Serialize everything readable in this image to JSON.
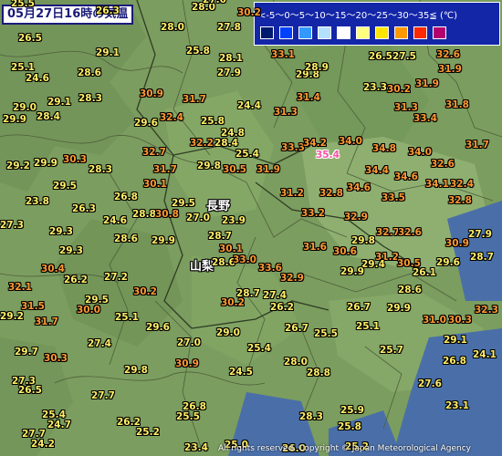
{
  "title": "05月27日16時の気温",
  "legend": {
    "scale_text": "<-5～0～5～10～15～20～25～30～35≦ (℃)",
    "colors": [
      "#001a6e",
      "#0040ff",
      "#3399ff",
      "#b3e0ff",
      "#ffffff",
      "#ffff80",
      "#ffe600",
      "#ff9900",
      "#ff2800",
      "#b4006e"
    ]
  },
  "places": {
    "nagano": "長野",
    "yamanashi": "山梨"
  },
  "copyright": "All rights reserved. Copyright © Japan Meteorological Agency",
  "max_value": "35.4",
  "colors": {
    "hot": "#ff9933",
    "warm": "#ffee66",
    "max": "#ff4fa6"
  },
  "temperatures": [
    {
      "v": "28.0"
    },
    {
      "v": "27.0"
    },
    {
      "v": "26.3"
    },
    {
      "v": "28.0"
    },
    {
      "v": "27.8"
    },
    {
      "v": "30.2"
    },
    {
      "v": "25.5"
    },
    {
      "v": "26.5"
    },
    {
      "v": "29.1"
    },
    {
      "v": "25.8"
    },
    {
      "v": "28.1"
    },
    {
      "v": "33.1"
    },
    {
      "v": "26.5"
    },
    {
      "v": "27.5"
    },
    {
      "v": "32.6"
    },
    {
      "v": "25.1"
    },
    {
      "v": "24.6"
    },
    {
      "v": "27.9"
    },
    {
      "v": "28.6"
    },
    {
      "v": "29.8"
    },
    {
      "v": "28.9"
    },
    {
      "v": "31.9"
    },
    {
      "v": "29.0"
    },
    {
      "v": "29.1"
    },
    {
      "v": "28.3"
    },
    {
      "v": "30.9"
    },
    {
      "v": "31.7"
    },
    {
      "v": "31.4"
    },
    {
      "v": "23.3"
    },
    {
      "v": "30.2"
    },
    {
      "v": "31.9"
    },
    {
      "v": "28.4"
    },
    {
      "v": "29.9"
    },
    {
      "v": "24.4"
    },
    {
      "v": "31.3"
    },
    {
      "v": "31.3"
    },
    {
      "v": "31.8"
    },
    {
      "v": "29.6"
    },
    {
      "v": "32.4"
    },
    {
      "v": "25.8"
    },
    {
      "v": "33.4"
    },
    {
      "v": "24.8"
    },
    {
      "v": "32.7"
    },
    {
      "v": "32.2"
    },
    {
      "v": "28.4"
    },
    {
      "v": "33.3"
    },
    {
      "v": "34.2"
    },
    {
      "v": "34.0"
    },
    {
      "v": "34.8"
    },
    {
      "v": "34.0"
    },
    {
      "v": "31.7"
    },
    {
      "v": "29.2"
    },
    {
      "v": "29.9"
    },
    {
      "v": "30.3"
    },
    {
      "v": "25.4"
    },
    {
      "v": "32.6"
    },
    {
      "v": "28.3"
    },
    {
      "v": "31.7"
    },
    {
      "v": "29.8"
    },
    {
      "v": "30.5"
    },
    {
      "v": "31.9"
    },
    {
      "v": "34.4"
    },
    {
      "v": "34.6"
    },
    {
      "v": "34.1"
    },
    {
      "v": "30.1"
    },
    {
      "v": "34.6"
    },
    {
      "v": "32.4"
    },
    {
      "v": "23.8"
    },
    {
      "v": "29.5"
    },
    {
      "v": "26.8"
    },
    {
      "v": "31.2"
    },
    {
      "v": "32.8"
    },
    {
      "v": "33.5"
    },
    {
      "v": "32.8"
    },
    {
      "v": "26.3"
    },
    {
      "v": "29.5"
    },
    {
      "v": "27.3"
    },
    {
      "v": "24.6"
    },
    {
      "v": "28.8"
    },
    {
      "v": "30.8"
    },
    {
      "v": "27.0"
    },
    {
      "v": "23.9"
    },
    {
      "v": "33.2"
    },
    {
      "v": "32.9"
    },
    {
      "v": "32.7"
    },
    {
      "v": "32.6"
    },
    {
      "v": "29.3"
    },
    {
      "v": "28.6"
    },
    {
      "v": "29.9"
    },
    {
      "v": "28.7"
    },
    {
      "v": "29.8"
    },
    {
      "v": "30.9"
    },
    {
      "v": "27.9"
    },
    {
      "v": "29.3"
    },
    {
      "v": "30.1"
    },
    {
      "v": "31.6"
    },
    {
      "v": "30.6"
    },
    {
      "v": "31.2"
    },
    {
      "v": "29.4"
    },
    {
      "v": "29.6"
    },
    {
      "v": "28.7"
    },
    {
      "v": "30.4"
    },
    {
      "v": "26.2"
    },
    {
      "v": "27.2"
    },
    {
      "v": "28.6"
    },
    {
      "v": "33.0"
    },
    {
      "v": "33.6"
    },
    {
      "v": "29.9"
    },
    {
      "v": "30.5"
    },
    {
      "v": "26.1"
    },
    {
      "v": "32.1"
    },
    {
      "v": "30.2"
    },
    {
      "v": "28.7"
    },
    {
      "v": "27.4"
    },
    {
      "v": "32.9"
    },
    {
      "v": "28.6"
    },
    {
      "v": "29.5"
    },
    {
      "v": "30.2"
    },
    {
      "v": "26.2"
    },
    {
      "v": "31.5"
    },
    {
      "v": "30.0"
    },
    {
      "v": "26.7"
    },
    {
      "v": "29.9"
    },
    {
      "v": "32.3"
    },
    {
      "v": "30.3"
    },
    {
      "v": "29.2"
    },
    {
      "v": "25.1"
    },
    {
      "v": "31.7"
    },
    {
      "v": "29.6"
    },
    {
      "v": "26.7"
    },
    {
      "v": "25.1"
    },
    {
      "v": "31.0"
    },
    {
      "v": "29.0"
    },
    {
      "v": "25.5"
    },
    {
      "v": "27.4"
    },
    {
      "v": "27.0"
    },
    {
      "v": "25.4"
    },
    {
      "v": "25.7"
    },
    {
      "v": "29.1"
    },
    {
      "v": "29.7"
    },
    {
      "v": "30.3"
    },
    {
      "v": "29.8"
    },
    {
      "v": "30.9"
    },
    {
      "v": "28.0"
    },
    {
      "v": "26.8"
    },
    {
      "v": "24.1"
    },
    {
      "v": "24.5"
    },
    {
      "v": "28.8"
    },
    {
      "v": "27.3"
    },
    {
      "v": "27.7"
    },
    {
      "v": "27.6"
    },
    {
      "v": "23.1"
    },
    {
      "v": "26.5"
    },
    {
      "v": "26.8"
    },
    {
      "v": "25.4"
    },
    {
      "v": "28.3"
    },
    {
      "v": "25.9"
    },
    {
      "v": "25.8"
    },
    {
      "v": "26.2"
    },
    {
      "v": "25.5"
    },
    {
      "v": "24.7"
    },
    {
      "v": "27.7"
    },
    {
      "v": "25.2"
    },
    {
      "v": "24.2"
    },
    {
      "v": "25.0"
    },
    {
      "v": "23.4"
    },
    {
      "v": "26.0"
    },
    {
      "v": "25.2"
    }
  ]
}
